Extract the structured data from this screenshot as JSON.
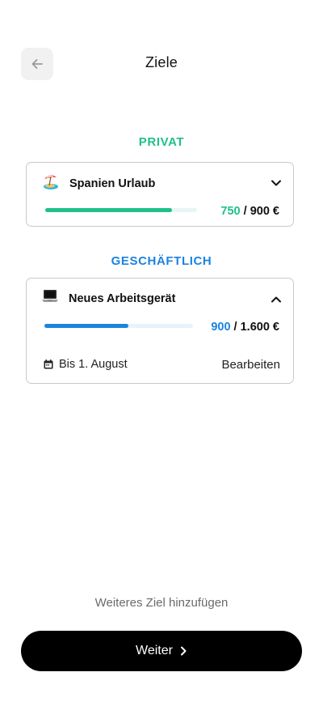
{
  "header": {
    "title": "Ziele",
    "back_icon": "arrow-left-icon"
  },
  "colors": {
    "private_accent": "#1fc08a",
    "business_accent": "#1a84e0",
    "track_private": "#e6f6f4",
    "track_business": "#e8f2fb"
  },
  "sections": {
    "privat": {
      "title": "PRIVAT",
      "goal": {
        "icon": "beach-umbrella-icon",
        "title": "Spanien Urlaub",
        "current": "750",
        "target": " / 900 €",
        "progress": 0.833,
        "expanded": false
      }
    },
    "business": {
      "title": "GESCHÄFTLICH",
      "goal": {
        "icon": "laptop-icon",
        "title": "Neues Arbeitsgerät",
        "current": "900",
        "target": " / 1.600 €",
        "progress": 0.5625,
        "expanded": true,
        "due": "Bis 1. August",
        "edit_label": "Bearbeiten"
      }
    }
  },
  "footer": {
    "add_goal": "Weiteres Ziel hinzufügen",
    "next_label": "Weiter"
  }
}
